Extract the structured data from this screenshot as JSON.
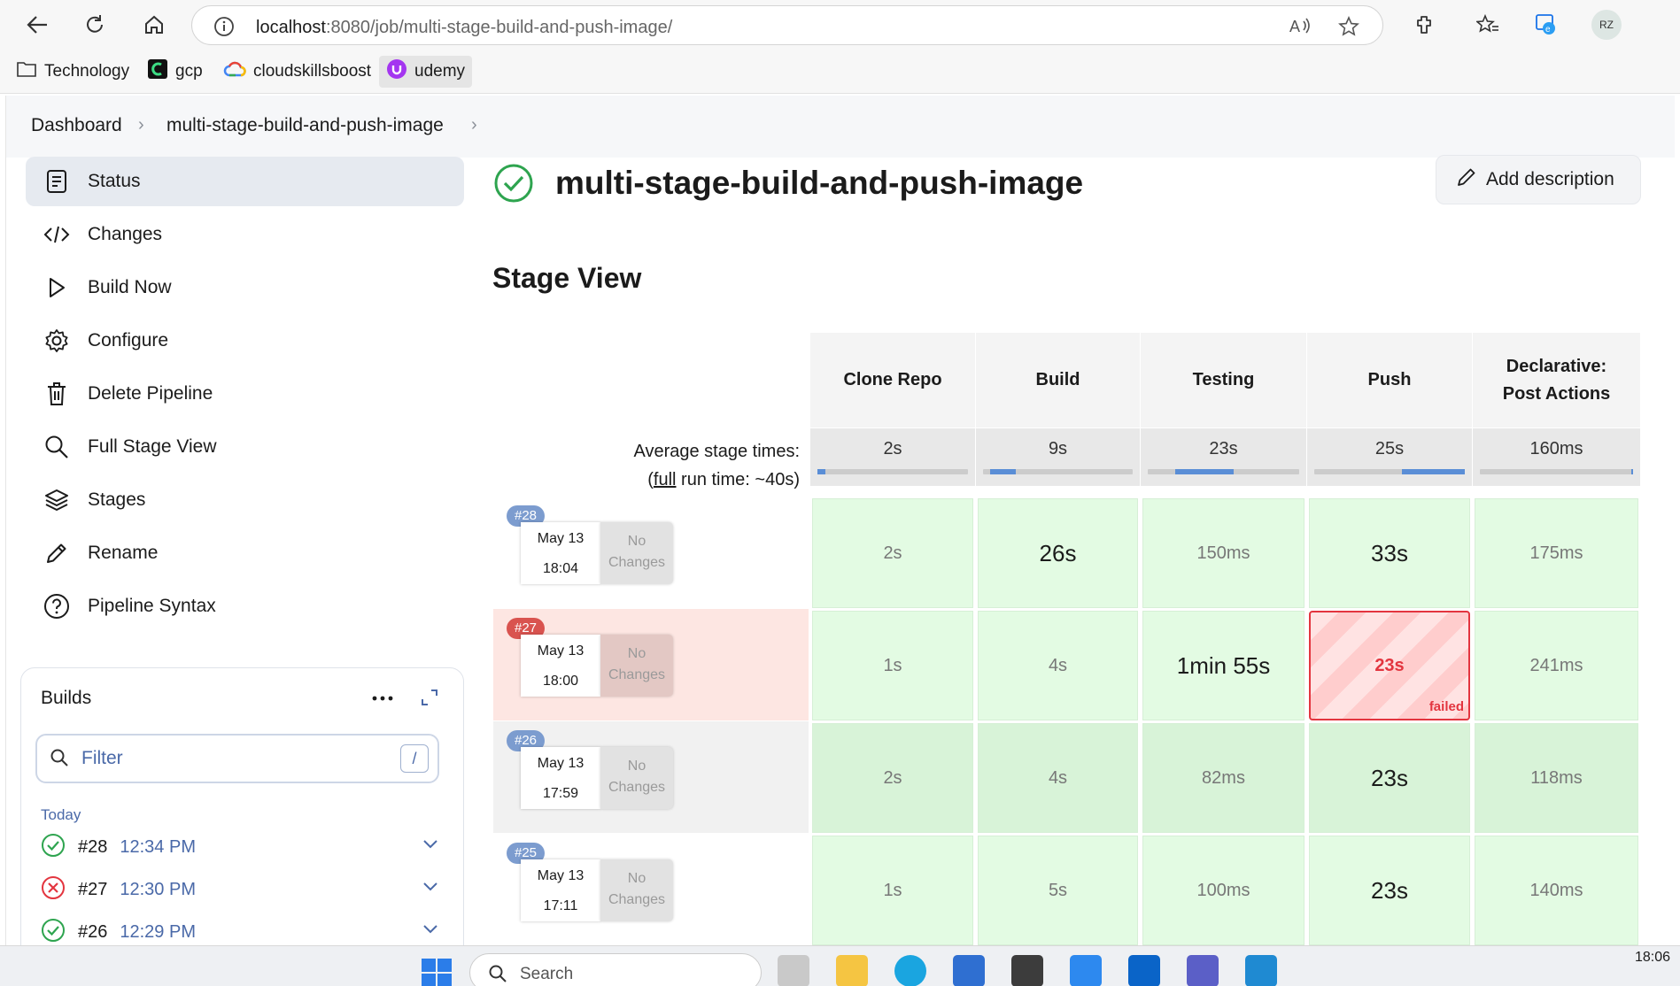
{
  "browser": {
    "url_host": "localhost",
    "url_rest": ":8080/job/multi-stage-build-and-push-image/",
    "avatar_initials": "RZ",
    "bookmarks": [
      "Technology",
      "gcp",
      "cloudskillsboost",
      "udemy"
    ]
  },
  "breadcrumb": {
    "items": [
      "Dashboard",
      "multi-stage-build-and-push-image"
    ]
  },
  "sidebar": {
    "items": [
      {
        "label": "Status",
        "icon": "status-doc-icon"
      },
      {
        "label": "Changes",
        "icon": "code-icon"
      },
      {
        "label": "Build Now",
        "icon": "play-icon"
      },
      {
        "label": "Configure",
        "icon": "gear-icon"
      },
      {
        "label": "Delete Pipeline",
        "icon": "trash-icon"
      },
      {
        "label": "Full Stage View",
        "icon": "search-icon"
      },
      {
        "label": "Stages",
        "icon": "layers-icon"
      },
      {
        "label": "Rename",
        "icon": "pencil-icon"
      },
      {
        "label": "Pipeline Syntax",
        "icon": "help-icon"
      }
    ]
  },
  "builds_panel": {
    "title": "Builds",
    "filter_placeholder": "Filter",
    "filter_shortcut": "/",
    "group_label": "Today",
    "rows": [
      {
        "number": "#28",
        "time": "12:34 PM",
        "status": "success"
      },
      {
        "number": "#27",
        "time": "12:30 PM",
        "status": "failed"
      },
      {
        "number": "#26",
        "time": "12:29 PM",
        "status": "success"
      }
    ]
  },
  "job": {
    "title": "multi-stage-build-and-push-image",
    "add_description_label": "Add description"
  },
  "stage_view": {
    "title": "Stage View",
    "avg_label_line1": "Average stage times:",
    "avg_label_full": "full",
    "avg_label_rest": " run time: ~40s)",
    "avg_label_open": "(",
    "stages": [
      {
        "name": "Clone Repo",
        "avg": "2s",
        "bar_from": 0.0,
        "bar_to": 0.05
      },
      {
        "name": "Build",
        "avg": "9s",
        "bar_from": 0.05,
        "bar_to": 0.22
      },
      {
        "name": "Testing",
        "avg": "23s",
        "bar_from": 0.18,
        "bar_to": 0.57
      },
      {
        "name": "Push",
        "avg": "25s",
        "bar_from": 0.58,
        "bar_to": 1.0
      },
      {
        "name": "Declarative: Post Actions",
        "name_line1": "Declarative:",
        "name_line2": "Post Actions",
        "avg": "160ms",
        "bar_from": 0.99,
        "bar_to": 1.0
      }
    ],
    "runs": [
      {
        "badge": "#28",
        "date": "May 13",
        "time": "18:04",
        "changes": [
          "No",
          "Changes"
        ],
        "failed": false,
        "cells": [
          "2s",
          "26s",
          "150ms",
          "33s",
          "175ms"
        ]
      },
      {
        "badge": "#27",
        "date": "May 13",
        "time": "18:00",
        "changes": [
          "No",
          "Changes"
        ],
        "failed": true,
        "cells": [
          "1s",
          "4s",
          "1min 55s",
          "23s",
          "241ms"
        ],
        "failed_label": "failed"
      },
      {
        "badge": "#26",
        "date": "May 13",
        "time": "17:59",
        "changes": [
          "No",
          "Changes"
        ],
        "failed": false,
        "cells": [
          "2s",
          "4s",
          "82ms",
          "23s",
          "118ms"
        ]
      },
      {
        "badge": "#25",
        "date": "May 13",
        "time": "17:11",
        "changes": [
          "No",
          "Changes"
        ],
        "failed": false,
        "cells": [
          "1s",
          "5s",
          "100ms",
          "23s",
          "140ms"
        ]
      }
    ]
  },
  "taskbar": {
    "search_placeholder": "Search",
    "clock": "18:06"
  },
  "colors": {
    "success_green": "#2ea44f",
    "failed_red": "#e3353f",
    "cell_green": "#e3fbe3",
    "badge_blue": "#7c9ccf",
    "badge_red": "#d9534f",
    "accent_blue": "#4a69a8"
  }
}
